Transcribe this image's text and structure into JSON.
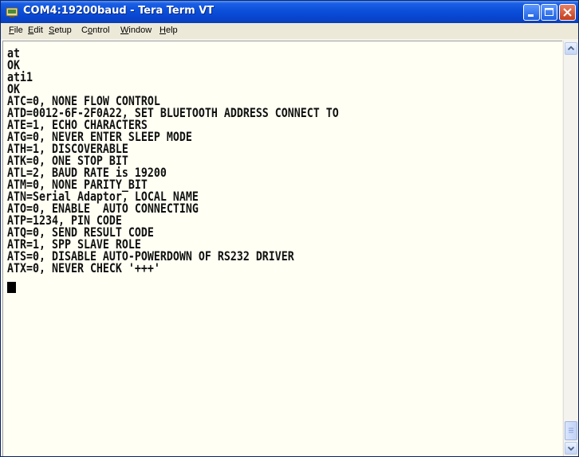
{
  "window": {
    "title": "COM4:19200baud - Tera Term VT",
    "icons": [
      "teraterm-app-icon",
      "minimize-icon",
      "maximize-icon",
      "close-icon"
    ]
  },
  "menu": {
    "items": [
      {
        "accel": "F",
        "rest": "ile"
      },
      {
        "accel": "E",
        "rest": "dit"
      },
      {
        "accel": "S",
        "rest": "etup"
      },
      {
        "prefix": "C",
        "accel": "o",
        "rest": "ntrol"
      },
      {
        "accel": "W",
        "rest": "indow"
      },
      {
        "accel": "H",
        "rest": "elp"
      }
    ]
  },
  "terminal": {
    "lines": [
      "at",
      "OK",
      "ati1",
      "OK",
      "ATC=0, NONE FLOW CONTROL",
      "ATD=0012-6F-2F0A22, SET BLUETOOTH ADDRESS CONNECT TO",
      "ATE=1, ECHO CHARACTERS",
      "ATG=0, NEVER ENTER SLEEP MODE",
      "ATH=1, DISCOVERABLE",
      "ATK=0, ONE STOP BIT",
      "ATL=2, BAUD RATE is 19200",
      "ATM=0, NONE PARITY_BIT",
      "ATN=Serial Adaptor, LOCAL NAME",
      "ATO=0, ENABLE  AUTO CONNECTING",
      "ATP=1234, PIN CODE",
      "ATQ=0, SEND RESULT CODE",
      "ATR=1, SPP SLAVE ROLE",
      "ATS=0, DISABLE AUTO-POWERDOWN OF RS232 DRIVER",
      "ATX=0, NEVER CHECK '+++'"
    ]
  },
  "colors": {
    "titlebar": "#0b4fd8",
    "menubar": "#ece9d8",
    "terminal_bg": "#fffff4",
    "terminal_text": "#111111"
  }
}
